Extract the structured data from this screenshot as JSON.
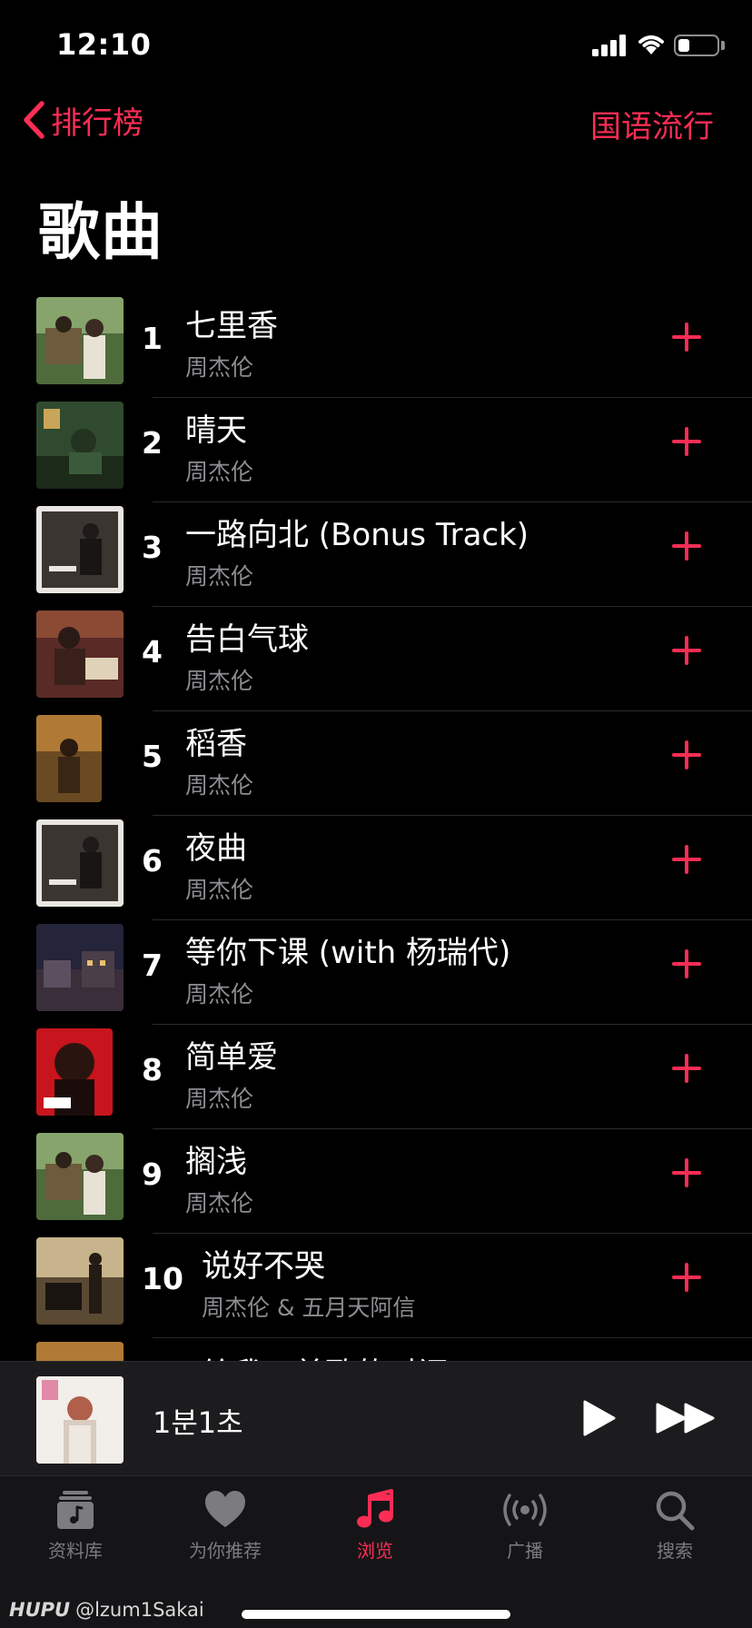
{
  "status_bar": {
    "time": "12:10"
  },
  "nav": {
    "back_label": "排行榜",
    "right_label": "国语流行"
  },
  "page_title": "歌曲",
  "songs": [
    {
      "rank": "1",
      "title": "七里香",
      "artist": "周杰伦"
    },
    {
      "rank": "2",
      "title": "晴天",
      "artist": "周杰伦"
    },
    {
      "rank": "3",
      "title": "一路向北 (Bonus Track)",
      "artist": "周杰伦"
    },
    {
      "rank": "4",
      "title": "告白气球",
      "artist": "周杰伦"
    },
    {
      "rank": "5",
      "title": "稻香",
      "artist": "周杰伦"
    },
    {
      "rank": "6",
      "title": "夜曲",
      "artist": "周杰伦"
    },
    {
      "rank": "7",
      "title": "等你下课 (with 杨瑞代)",
      "artist": "周杰伦"
    },
    {
      "rank": "8",
      "title": "简单爱",
      "artist": "周杰伦"
    },
    {
      "rank": "9",
      "title": "搁浅",
      "artist": "周杰伦"
    },
    {
      "rank": "10",
      "title": "说好不哭",
      "artist": "周杰伦 & 五月天阿信"
    },
    {
      "rank": "",
      "title": "给我一首歌的时间",
      "artist": ""
    }
  ],
  "mini_player": {
    "title": "1분1초"
  },
  "tabs": [
    {
      "label": "资料库",
      "icon": "library-icon"
    },
    {
      "label": "为你推荐",
      "icon": "heart-icon"
    },
    {
      "label": "浏览",
      "icon": "music-note-icon",
      "active": true
    },
    {
      "label": "广播",
      "icon": "radio-icon"
    },
    {
      "label": "搜索",
      "icon": "search-icon"
    }
  ],
  "watermark": {
    "brand": "HUPU",
    "handle": "@lzum1Sakai"
  },
  "colors": {
    "accent": "#fa2d55",
    "background": "#000000",
    "secondary_text": "#8d8d92"
  }
}
